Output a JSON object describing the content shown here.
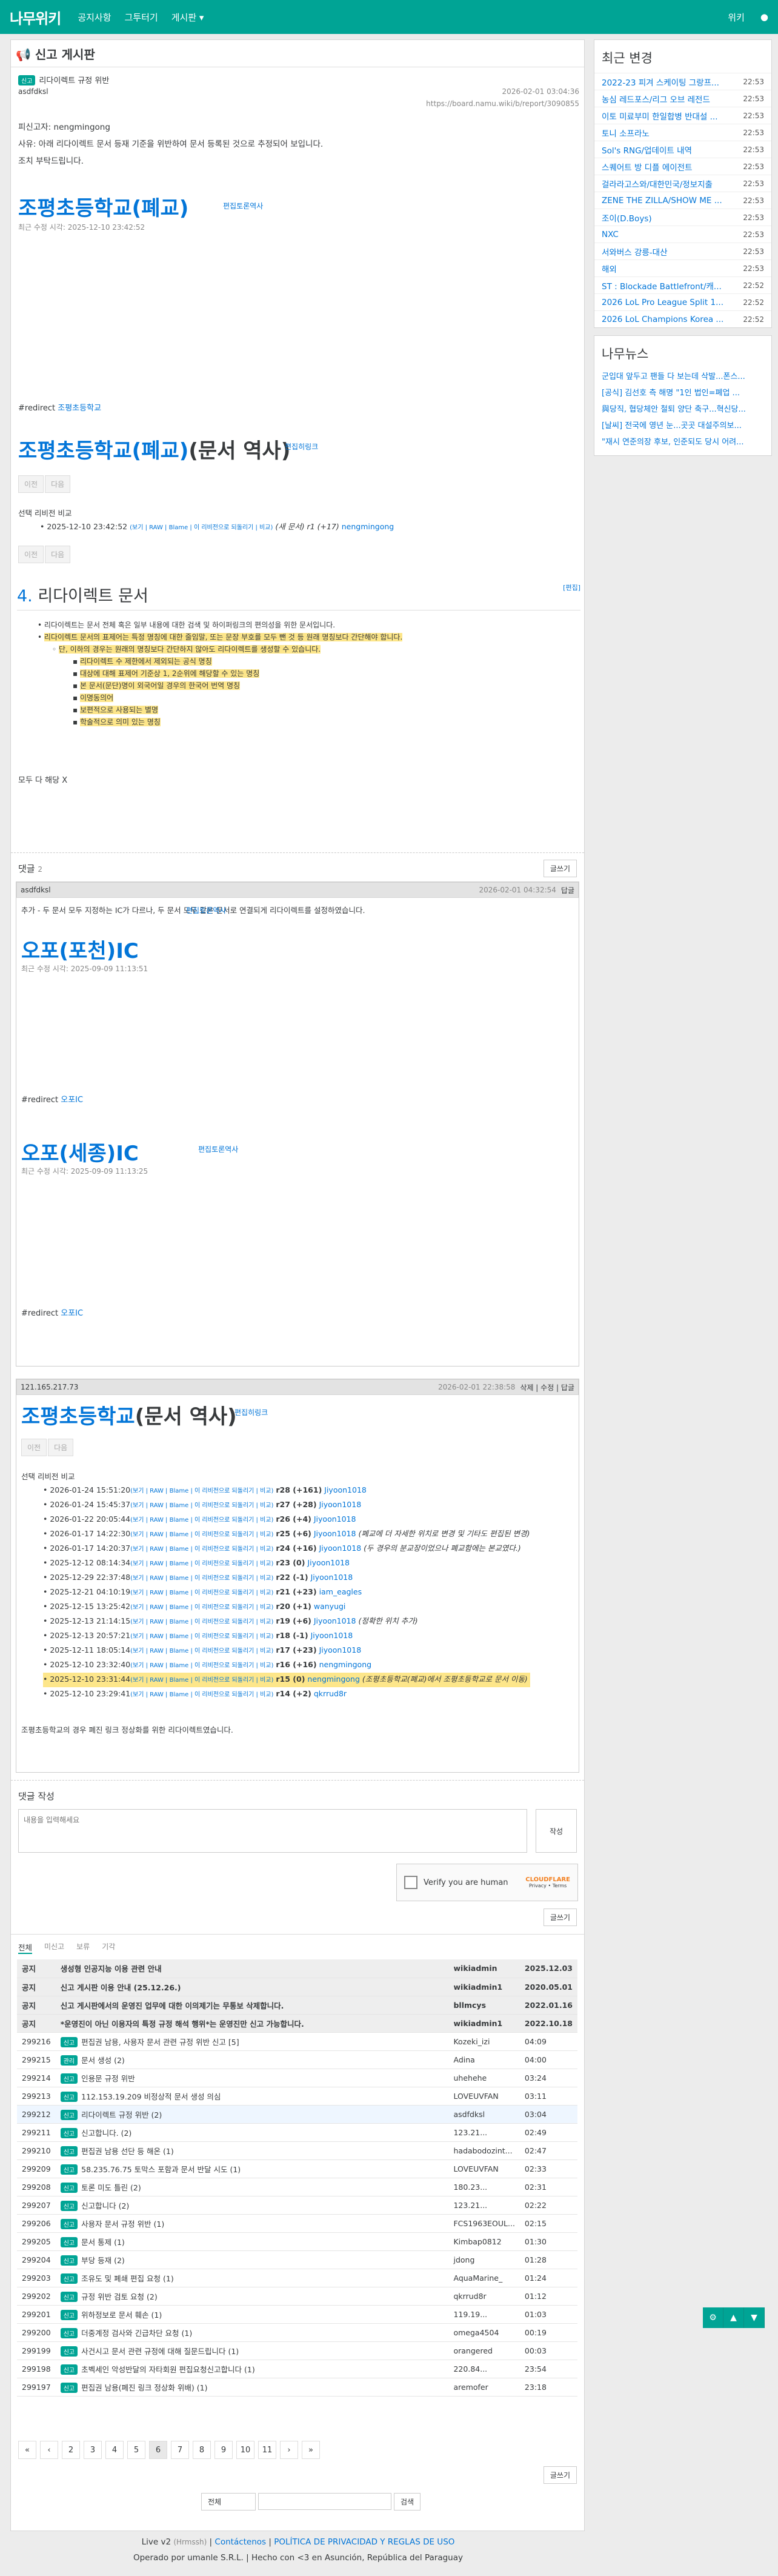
{
  "header": {
    "logo": "나무위키",
    "nav": [
      "공지사항",
      "그투터기",
      "게시판 ▾"
    ],
    "right": "위키"
  },
  "page": {
    "title": "신고 게시판",
    "tag": "신고",
    "subject": "리다이렉트 규정 위반",
    "author": "asdfdksl",
    "date": "2026-02-01 03:04:36",
    "url": "https://board.namu.wiki/b/report/3090855",
    "body": [
      "피신고자: nengmingong",
      "사유: 아래 리다이렉트 문서 등재 기준을 위반하여 문서 등록된 것으로 추정되어 보입니다.",
      "조치 부탁드립니다."
    ]
  },
  "doc1": {
    "title": "조평초등학교(폐교)",
    "edit": "편집토론역사",
    "modified": "최근 수정 시각: 2025-12-10 23:42:52",
    "redirect_label": "#redirect",
    "redirect": "조평초등학교"
  },
  "doc2": {
    "title_link": "조평초등학교(폐교)",
    "title_rest": "(문서 역사)",
    "edit": "편집히링크",
    "btn1": "이전",
    "btn2": "다음",
    "compare": "선택 리비전 비교",
    "row": "2025-12-10 23:42:52",
    "row_links": "(보기 | RAW | Blame | 이 리비전으로 되돌리기 | 비교)",
    "row_note": "(새 문서) r1 (+17)",
    "row_user": "nengmingong"
  },
  "rules": {
    "num": "4.",
    "title": "리다이렉트 문서",
    "edit": "[편집]",
    "items": [
      "리다이렉트는 문서 전체 혹은 일부 내용에 대한 검색 및 하이퍼링크의 편의성을 위한 문서입니다.",
      "리다이렉트 문서의 표제어는 특정 명칭에 대한 줄임말, 또는 문장 부호를 모두 뺀 것 등 원래 명칭보다 간단해야 합니다.",
      "단, 이하의 경우는 원래의 명칭보다 간단하지 않아도 리다이렉트를 생성할 수 있습니다.",
      "리다이렉트 수 제한에서 제외되는 공식 명칭",
      "대상에 대해 표제어 기준상 1, 2순위에 해당할 수 있는 명칭",
      "본 문서(문단)명이 외국어일 경우의 한국어 번역 명칭",
      "이명동의어",
      "보편적으로 사용되는 별명",
      "학술적으로 의미 있는 명칭"
    ],
    "foot": "모두 다 해당 X"
  },
  "comments": {
    "label": "댓글",
    "count": "2",
    "write": "글쓰기",
    "c1": {
      "user": "asdfdksl",
      "date": "2026-02-01 04:32:54",
      "reply": "답글",
      "text": "추가 - 두 문서 모두 지정하는 IC가 다르나, 두 문서 모두 같은 문서로 연결되게 리다이렉트를 설정하였습니다.",
      "d1": {
        "title": "오포(포천)IC",
        "edit": "편집토론역사",
        "modified": "최근 수정 시각: 2025-09-09 11:13:51",
        "redirect": "오포IC"
      },
      "d2": {
        "title": "오포(세종)IC",
        "edit": "편집토론역사",
        "modified": "최근 수정 시각: 2025-09-09 11:13:25",
        "redirect": "오포IC"
      }
    },
    "c2": {
      "user": "121.165.217.73",
      "date": "2026-02-01 22:38:58",
      "actions": "삭제 | 수정 | 답글",
      "title_link": "조평초등학교",
      "title_rest": "(문서 역사)",
      "edit": "편집히링크",
      "compare": "선택 리비전 비교",
      "revs": [
        [
          "2026-01-24 15:51:20",
          "r28 (+161)",
          "Jiyoon1018",
          ""
        ],
        [
          "2026-01-24 15:45:37",
          "r27 (+28)",
          "Jiyoon1018",
          ""
        ],
        [
          "2026-01-22 20:05:44",
          "r26 (+4)",
          "Jiyoon1018",
          ""
        ],
        [
          "2026-01-17 14:22:30",
          "r25 (+6)",
          "Jiyoon1018",
          "(폐교에 더 자세한 위치로 변경 및 기타도 편집된 변경)"
        ],
        [
          "2026-01-17 14:20:37",
          "r24 (+16)",
          "Jiyoon1018",
          "(두 경우의 분교장이었으나 폐교함에는 본교였다.)"
        ],
        [
          "2025-12-12 08:14:34",
          "r23 (0)",
          "Jiyoon1018",
          ""
        ],
        [
          "2025-12-29 22:37:48",
          "r22 (-1)",
          "Jiyoon1018",
          ""
        ],
        [
          "2025-12-21 04:10:19",
          "r21 (+23)",
          "iam_eagles",
          ""
        ],
        [
          "2025-12-15 13:25:42",
          "r20 (+1)",
          "wanyugi",
          ""
        ],
        [
          "2025-12-13 21:14:15",
          "r19 (+6)",
          "Jiyoon1018",
          "(정확한 위치 추가)"
        ],
        [
          "2025-12-13 20:57:21",
          "r18 (-1)",
          "Jiyoon1018",
          ""
        ],
        [
          "2025-12-11 18:05:14",
          "r17 (+23)",
          "Jiyoon1018",
          ""
        ],
        [
          "2025-12-10 23:32:40",
          "r16 (+16)",
          "nengmingong",
          ""
        ],
        [
          "2025-12-10 23:31:44",
          "r15 (0)",
          "nengmingong",
          "(조평초등학교(폐교)에서 조평초등학교로 문서 이동)"
        ],
        [
          "2025-12-10 23:29:41",
          "r14 (+2)",
          "qkrrud8r",
          ""
        ]
      ],
      "text": "조평초등학교의 경우 폐진 링크 정상화를 위한 리다이렉트였습니다."
    }
  },
  "compose": {
    "label": "댓글 작성",
    "placeholder": "내용을 입력해세요",
    "submit": "작성",
    "captcha": "Verify you are human",
    "cf": "CLOUDFLARE",
    "cf_sub": "Privacy • Terms",
    "write": "글쓰기"
  },
  "list": {
    "tabs": [
      "전체",
      "미신고",
      "보류",
      "기각"
    ],
    "notices": [
      [
        "공지",
        "생성형 인공지능 이용 관련 안내",
        "wikiadmin",
        "2025.12.03"
      ],
      [
        "공지",
        "신고 게시판 이용 안내 (25.12.26.)",
        "wikiadmin1",
        "2020.05.01"
      ],
      [
        "공지",
        "신고 게시판에서의 운영진 업무에 대한 이의제기는 무통보 삭제합니다.",
        "bllmcys",
        "2022.01.16"
      ],
      [
        "공지",
        "*운영진이 아닌 이용자의 특정 규정 해석 행위*는 운영진만 신고 가능합니다.",
        "wikiadmin1",
        "2022.10.18"
      ]
    ],
    "rows": [
      [
        "299216",
        "신고",
        "편집권 남용, 사용자 문서 관련 규정 위반 신고 [5]",
        "Kozeki_izi",
        "04:09"
      ],
      [
        "299215",
        "관리",
        "문서 생성 (2)",
        "Adina",
        "04:00"
      ],
      [
        "299214",
        "신고",
        "인용문 규정 위반",
        "uhehehe",
        "03:24"
      ],
      [
        "299213",
        "신고",
        "112.153.19.209 비정상적 문서 생성 의심",
        "LOVEUVFAN",
        "03:11"
      ],
      [
        "299212",
        "신고",
        "리다이렉트 규정 위반 (2)",
        "asdfdksl",
        "03:04"
      ],
      [
        "299211",
        "신고",
        "신고합니다. (2)",
        "123.21...",
        "02:49"
      ],
      [
        "299210",
        "신고",
        "편집권 남용 선단 등 해온 (1)",
        "hadabodozint...",
        "02:47"
      ],
      [
        "299209",
        "신고",
        "58.235.76.75 토막스 포함과 문서 반달 시도 (1)",
        "LOVEUVFAN",
        "02:33"
      ],
      [
        "299208",
        "신고",
        "토론 미도 틀린 (2)",
        "180.23...",
        "02:31"
      ],
      [
        "299207",
        "신고",
        "신고합니다 (2)",
        "123.21...",
        "02:22"
      ],
      [
        "299206",
        "신고",
        "사용자 문서 규정 위반 (1)",
        "FCS1963EOUL...",
        "02:15"
      ],
      [
        "299205",
        "신고",
        "문서 통제 (1)",
        "Kimbap0812",
        "01:30"
      ],
      [
        "299204",
        "신고",
        "부당 등재 (2)",
        "jdong",
        "01:28"
      ],
      [
        "299203",
        "신고",
        "조유도 및 폐쇄 편집 요청 (1)",
        "AquaMarine_",
        "01:24"
      ],
      [
        "299202",
        "신고",
        "규정 위반 검토 요청 (2)",
        "qkrrud8r",
        "01:12"
      ],
      [
        "299201",
        "신고",
        "위하정보로 문서 훼손 (1)",
        "119.19...",
        "01:03"
      ],
      [
        "299200",
        "신고",
        "더중계정 검사와 긴급차단 요청 (1)",
        "omega4504",
        "00:19"
      ],
      [
        "299199",
        "신고",
        "사건시고 문서 관련 규정에 대해 질문드립니다 (1)",
        "orangered",
        "00:03"
      ],
      [
        "299198",
        "신고",
        "초벡세인 악성반달의 자타회원 편집요청신고합니다 (1)",
        "220.84...",
        "23:54"
      ],
      [
        "299197",
        "신고",
        "편집권 남용(폐진 링크 정상화 위배) (1)",
        "aremofer",
        "23:18"
      ]
    ],
    "pages": [
      "«",
      "‹",
      "2",
      "3",
      "4",
      "5",
      "6",
      "7",
      "8",
      "9",
      "10",
      "11",
      "›",
      "»"
    ],
    "current": "6",
    "write": "글쓰기",
    "search_select": "전체",
    "search_btn": "검색"
  },
  "footer": {
    "line1a": "Live v2",
    "line1b": "(Hrmssh)",
    "line1c": "Contáctenos",
    "line1d": "POLÍTICA DE PRIVACIDAD Y REGLAS DE USO",
    "line2": "Operado por umanle S.R.L.  |  Hecho con <3 en Asunción, República del Paraguay"
  },
  "sidebar": {
    "recent_title": "최근 변경",
    "recent": [
      [
        "2022-23 피겨 스케이팅 그랑프...",
        "22:53"
      ],
      [
        "농심 레드포스/리그 오브 레전드",
        "22:53"
      ],
      [
        "이토 미료부미 한일합병 반대설 ...",
        "22:53"
      ],
      [
        "토니 소프라노",
        "22:53"
      ],
      [
        "Sol's RNG/업데이트 내역",
        "22:53"
      ],
      [
        "스퀘어트 방 디플 에이전트",
        "22:53"
      ],
      [
        "걸라라고스와/대한민국/정보지출",
        "22:53"
      ],
      [
        "ZENE THE ZILLA/SHOW ME ...",
        "22:53"
      ],
      [
        "조이(D.Boys)",
        "22:53"
      ],
      [
        "NXC",
        "22:53"
      ],
      [
        "서와버스 강릉-대산",
        "22:53"
      ],
      [
        "해외",
        "22:53"
      ],
      [
        "ST : Blockade Battlefront/캐...",
        "22:52"
      ],
      [
        "2026 LoL Pro League Split 1...",
        "22:52"
      ],
      [
        "2026 LoL Champions Korea ...",
        "22:52"
      ]
    ],
    "news_title": "나무뉴스",
    "news": [
      "군입대 앞두고 팬들 다 보는데 삭발...폰스...",
      "[공식] 김선호 측 해명 \"1인 법인=폐업 ...",
      "與당직, 협당체안 철퇴 양단 축구...혁신당...",
      "[날씨] 전국에 영년 눈...곳곳 대설주의보...",
      "\"재시 연준의장 후보, 인준되도 당시 어려..."
    ]
  }
}
